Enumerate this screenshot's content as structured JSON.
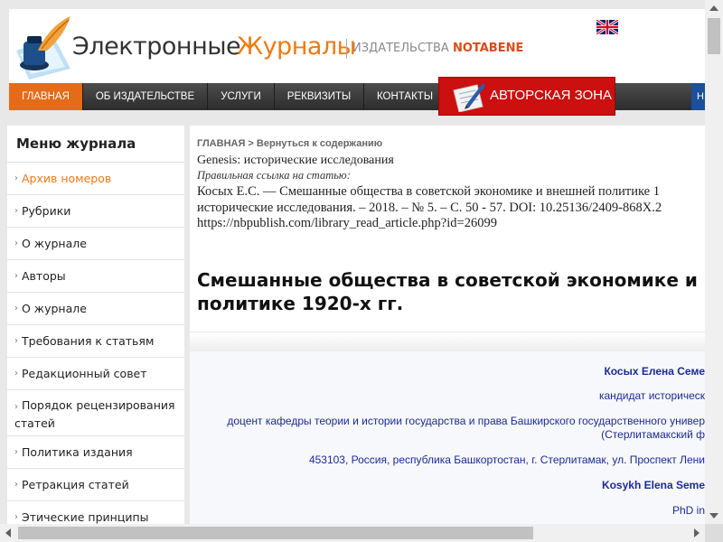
{
  "header": {
    "logo_word1": "Электронные",
    "logo_word2": "Журналы",
    "logo_sub": "ИЗДАТЕЛЬСТВА",
    "logo_brand": "NOTABENE",
    "flag_icon": "uk-flag-icon"
  },
  "nav": {
    "items": [
      "ГЛАВНАЯ",
      "ОБ ИЗДАТЕЛЬСТВЕ",
      "УСЛУГИ",
      "РЕКВИЗИТЫ",
      "КОНТАКТЫ"
    ],
    "author_zone": "АВТОРСКАЯ ЗОНА",
    "right_partial": "Н",
    "active_color": "#e66b18",
    "author_zone_color": "#cc0f0f"
  },
  "sidebar": {
    "title": "Меню журнала",
    "items": [
      "Архив номеров",
      "Рубрики",
      "О журнале",
      "Авторы",
      "О журнале",
      "Требования к статьям",
      "Редакционный совет",
      "Порядок рецензирования статей",
      "Политика издания",
      "Ретракция статей",
      "Этические принципы"
    ]
  },
  "content": {
    "breadcrumb_home": "ГЛАВНАЯ",
    "breadcrumb_back": "Вернуться к содержанию",
    "journal_name": "Genesis: исторические исследования",
    "ref_label": "Правильная ссылка на статью:",
    "ref_line1": "Косых Е.С. — Смешанные общества в советской экономике и внешней политике 1",
    "ref_line2": "исторические исследования. – 2018. – № 5. – С. 50 - 57. DOI: 10.25136/2409-868X.2",
    "ref_line3": "https://nbpublish.com/library_read_article.php?id=26099",
    "title_line1": "Смешанные общества в советской экономике и",
    "title_line2": "политике 1920-х гг.",
    "author_lines": [
      "Косых Елена Семе",
      "кандидат историческ",
      "доцент кафедры теории и истории государства и права Башкирского государственного универ",
      "(Стерлитамакский ф",
      "453103, Россия, республика Башкортостан, г. Стерлитамак, ул. Проспект Лени",
      "Kosykh Elena Seme",
      "PhD in"
    ]
  }
}
